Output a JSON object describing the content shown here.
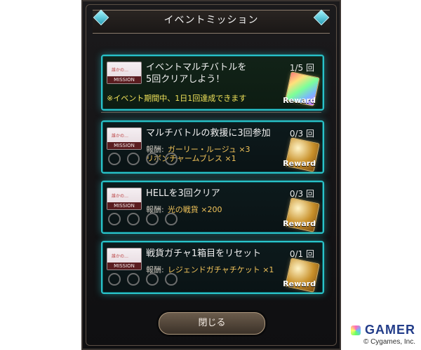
{
  "dialog": {
    "title": "イベントミッション",
    "close_label": "閉じる",
    "gem_icon": "diamond-gem-icon"
  },
  "missions": [
    {
      "thumb_text": "誰かの…",
      "thumb_label": "MISSION",
      "title_line1": "イベントマルチバトルを",
      "title_line2": "5回クリアしよう！",
      "progress": "1/5 回",
      "note": "※イベント期間中、1日1回達成できます",
      "reward_label": "Reward",
      "reward_icon": "reward-card-icon"
    },
    {
      "thumb_text": "誰かの…",
      "thumb_label": "MISSION",
      "title": "マルチバトルの救援に3回参加",
      "progress": "0/3 回",
      "reward_prefix": "報酬:",
      "reward_value_line1": "ガーリー・ルージュ ×3",
      "reward_value_line2": "リボンチャームブレス ×1",
      "reward_label": "Reward",
      "reward_icon": "reward-bundle-icon",
      "stars": 4
    },
    {
      "thumb_text": "誰かの…",
      "thumb_label": "MISSION",
      "title": "HELLを3回クリア",
      "progress": "0/3 回",
      "reward_prefix": "報酬:",
      "reward_value_line1": "光の戦貨 ×200",
      "reward_label": "Reward",
      "reward_icon": "reward-coin-icon",
      "stars": 4
    },
    {
      "thumb_text": "誰かの…",
      "thumb_label": "MISSION",
      "title": "戦貨ガチャ1箱目をリセット",
      "progress": "0/1 回",
      "reward_prefix": "報酬:",
      "reward_value_line1": "レジェンドガチャチケット ×1",
      "reward_label": "Reward",
      "reward_icon": "reward-ticket-icon",
      "stars": 4
    }
  ],
  "branding": {
    "logo": "GAMER",
    "copyright": "© Cygames, Inc."
  }
}
